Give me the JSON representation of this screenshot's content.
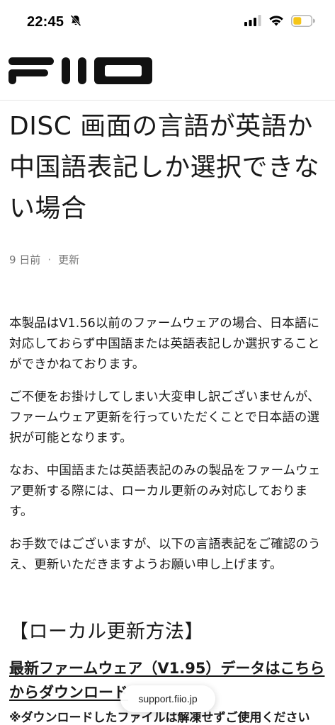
{
  "status_bar": {
    "time": "22:45",
    "bell_icon": "bell-slash-icon",
    "signal_icon": "cellular-signal-icon",
    "wifi_icon": "wifi-icon",
    "battery_icon": "battery-icon",
    "battery_color": "#f5c518"
  },
  "header": {
    "logo_text": "FIIO",
    "logo_color": "#111111"
  },
  "article": {
    "title": "DISC 画面の言語が英語か中国語表記しか選択できない場合",
    "meta": {
      "date": "9 日前",
      "separator": "·",
      "status": "更新"
    },
    "paragraphs": [
      "本製品はV1.56以前のファームウェアの場合、日本語に対応しておらず中国語または英語表記しか選択することができかねております。",
      "ご不便をお掛けしてしまい大変申し訳ございませんが、ファームウェア更新を行っていただくことで日本語の選択が可能となります。",
      "なお、中国語または英語表記のみの製品をファームウェア更新する際には、ローカル更新のみ対応しております。",
      "お手数ではございますが、以下の言語表記をご確認のうえ、更新いただきますようお願い申し上げます。"
    ],
    "section_heading": "【ローカル更新方法】",
    "download_link": "最新ファームウェア（V1.95）データはこちらからダウンロード",
    "note": "※ダウンロードしたファイルは解凍せずご使用ください"
  },
  "browser": {
    "url": "support.fiio.jp"
  }
}
